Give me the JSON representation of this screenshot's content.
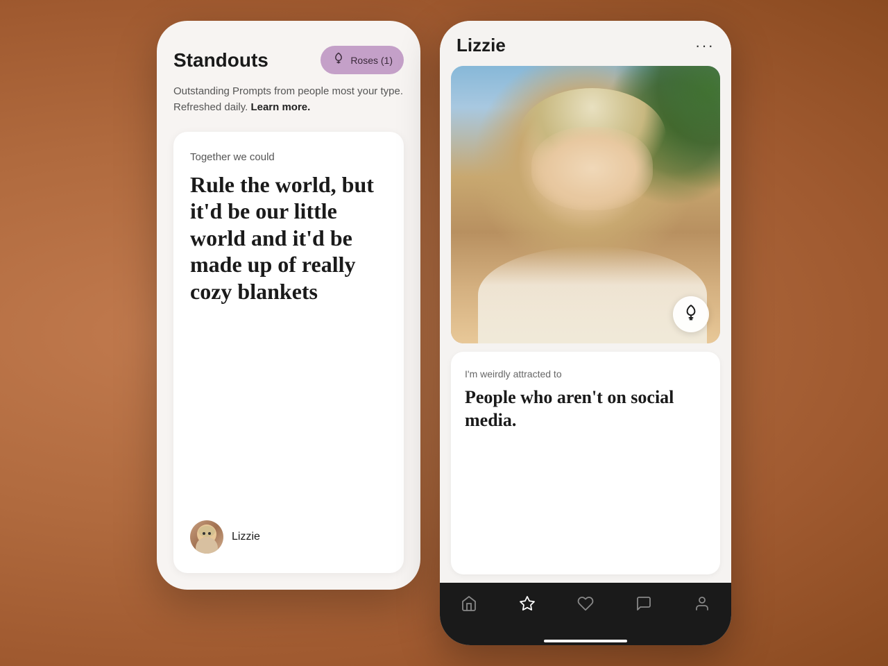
{
  "background": {
    "color": "#c17a4e"
  },
  "left_phone": {
    "title": "Standouts",
    "roses_button": {
      "icon": "🌹",
      "label": "Roses (1)"
    },
    "description": "Outstanding Prompts from people most your type. Refreshed daily.",
    "learn_more": "Learn more.",
    "prompt_card": {
      "label": "Together we could",
      "answer": "Rule the world, but it'd be our little world and it'd be made up of really cozy blankets",
      "user_name": "Lizzie"
    }
  },
  "right_phone": {
    "profile_name": "Lizzie",
    "more_icon": "•••",
    "rose_button_icon": "🌹",
    "prompt_card": {
      "label": "I'm weirdly attracted to",
      "answer": "People who aren't on social media."
    },
    "nav": {
      "items": [
        {
          "icon": "H",
          "label": "home",
          "active": false
        },
        {
          "icon": "☆",
          "label": "standouts",
          "active": true
        },
        {
          "icon": "♡",
          "label": "likes",
          "active": false
        },
        {
          "icon": "◻",
          "label": "messages",
          "active": false
        },
        {
          "icon": "⌀",
          "label": "profile",
          "active": false
        }
      ]
    }
  }
}
